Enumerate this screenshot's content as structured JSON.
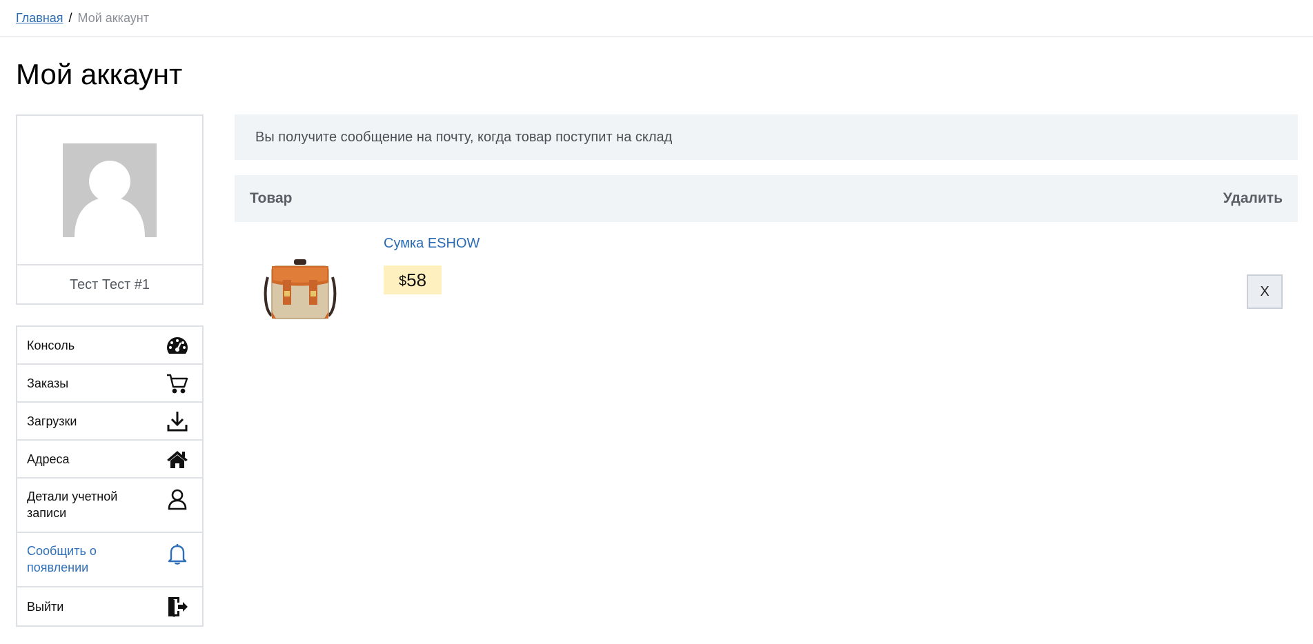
{
  "breadcrumb": {
    "home": "Главная",
    "separator": "/",
    "current": "Мой аккаунт"
  },
  "page_title": "Мой аккаунт",
  "profile": {
    "name": "Тест Тест #1",
    "avatar_icon": "user-placeholder-icon"
  },
  "nav": {
    "items": [
      {
        "label": "Консоль",
        "icon": "dashboard-icon"
      },
      {
        "label": "Заказы",
        "icon": "cart-icon"
      },
      {
        "label": "Загрузки",
        "icon": "download-icon"
      },
      {
        "label": "Адреса",
        "icon": "home-icon"
      },
      {
        "label": "Детали учетной записи",
        "icon": "user-icon"
      },
      {
        "label": "Сообщить о появлении",
        "icon": "bell-icon",
        "active": true
      },
      {
        "label": "Выйти",
        "icon": "logout-icon"
      }
    ]
  },
  "notice": "Вы получите сообщение на почту, когда товар поступит на склад",
  "table": {
    "col_product": "Товар",
    "col_remove": "Удалить",
    "rows": [
      {
        "name": "Сумка ESHOW",
        "currency": "$",
        "price": "58",
        "remove_label": "X"
      }
    ]
  },
  "colors": {
    "link": "#2a6bb3",
    "active_nav": "#2f6fba",
    "notice_bg": "#f1f4f7",
    "price_bg": "#fff1bf",
    "border": "#dde1e6"
  }
}
